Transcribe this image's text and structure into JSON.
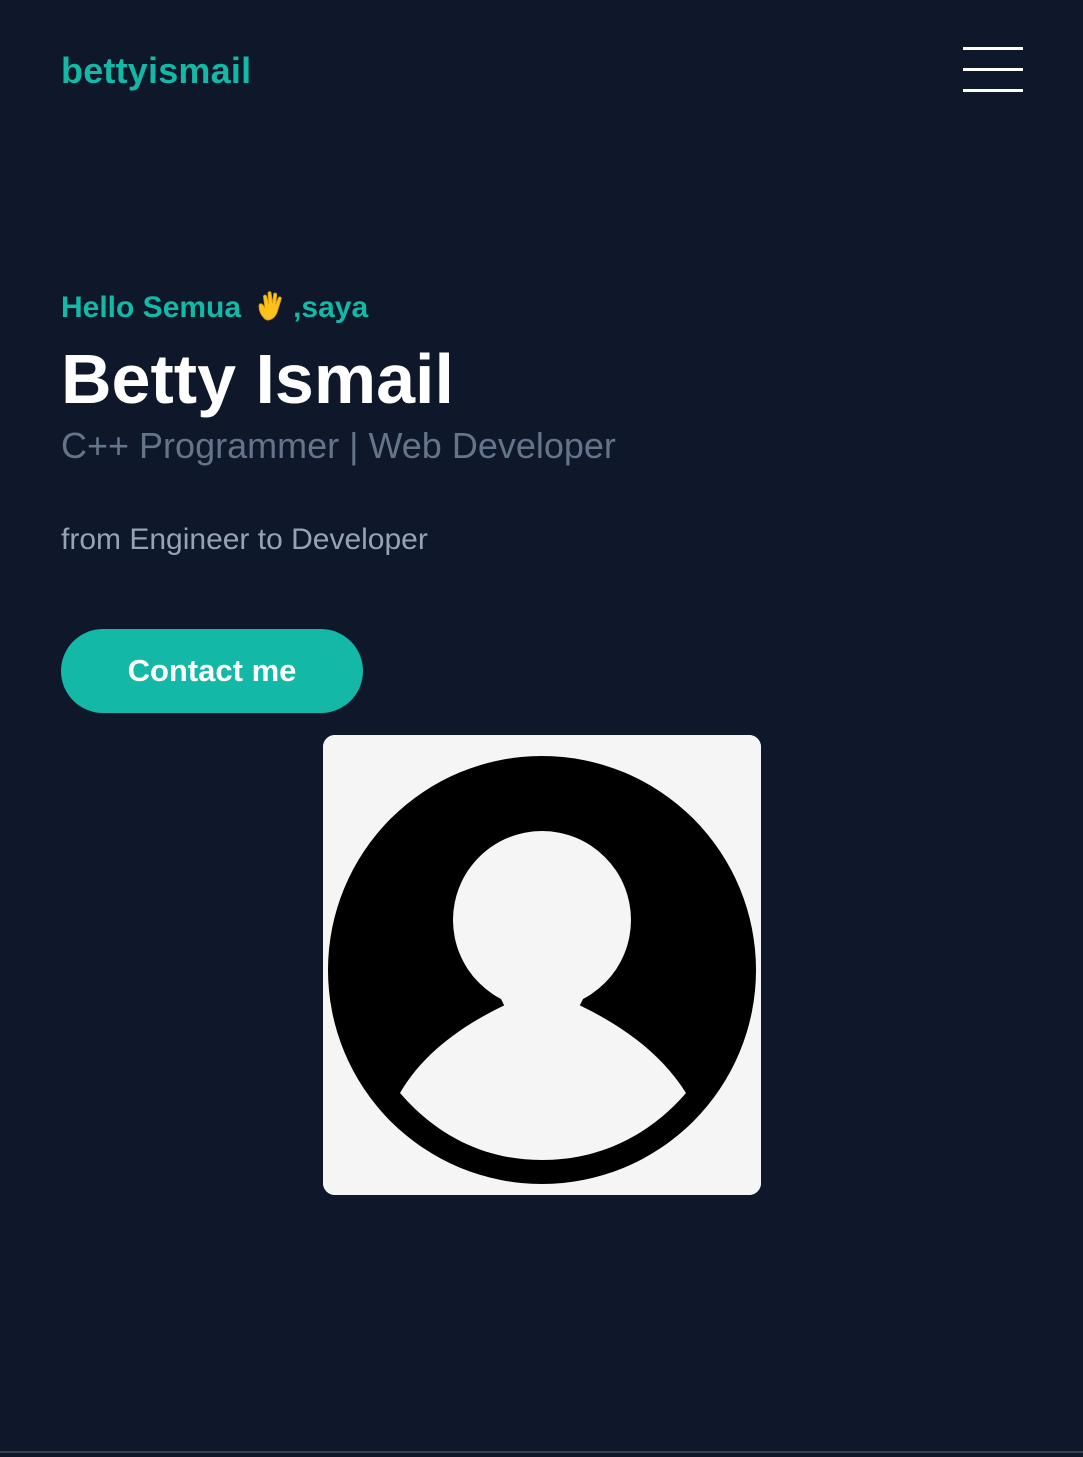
{
  "header": {
    "logo_text": "bettyismail",
    "menu_icon": "hamburger-menu-icon"
  },
  "hero": {
    "greeting_prefix": "Hello Semua",
    "greeting_icon": "waving-hand-icon",
    "greeting_suffix": ",saya",
    "name": "Betty Ismail",
    "role": "C++ Programmer | Web Developer",
    "tagline": "from Engineer to Developer",
    "contact_label": "Contact me"
  },
  "profile": {
    "image_icon": "user-avatar-placeholder-icon"
  },
  "colors": {
    "background": "#0f172a",
    "accent": "#14b8a6",
    "heading": "#ffffff",
    "muted": "#64748b",
    "body_text": "#94a3b8"
  }
}
